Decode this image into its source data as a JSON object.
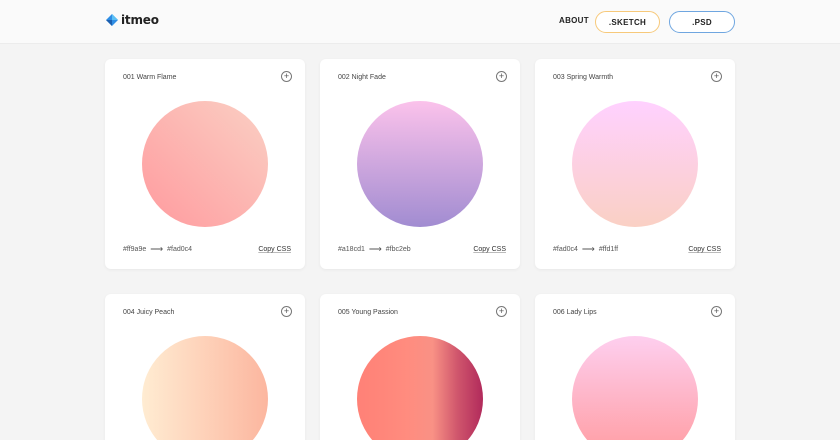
{
  "header": {
    "logo_text": "itmeo",
    "nav_about": "ABOUT",
    "sketch_label": ".SKETCH",
    "psd_label": ".PSD"
  },
  "copy_label": "Copy CSS",
  "cards": [
    {
      "title": "001 Warm Flame",
      "from": "#ff9a9e",
      "to": "#fad0c4",
      "gradient": [
        "#ff9a9e",
        "#fad0c4"
      ],
      "direction": "diag"
    },
    {
      "title": "002 Night Fade",
      "from": "#a18cd1",
      "to": "#fbc2eb",
      "gradient": [
        "#fbc2eb",
        "#a18cd1"
      ],
      "direction": "vert"
    },
    {
      "title": "003 Spring Warmth",
      "from": "#fad0c4",
      "to": "#ffd1ff",
      "gradient": [
        "#ffd1ff",
        "#fad0c4"
      ],
      "direction": "vert"
    },
    {
      "title": "004 Juicy Peach",
      "from": "",
      "to": "",
      "gradient": [
        "#ffecd2",
        "#fcb69f"
      ],
      "direction": "horiz"
    },
    {
      "title": "005 Young Passion",
      "from": "",
      "to": "",
      "gradient": [
        "#ff8177",
        "#ff867a",
        "#ff8c7f",
        "#f99185",
        "#cf556c",
        "#b12a5b"
      ],
      "direction": "horiz"
    },
    {
      "title": "006 Lady Lips",
      "from": "",
      "to": "",
      "gradient": [
        "#ff9a9e",
        "#fecfef"
      ],
      "direction": "vertup"
    }
  ]
}
